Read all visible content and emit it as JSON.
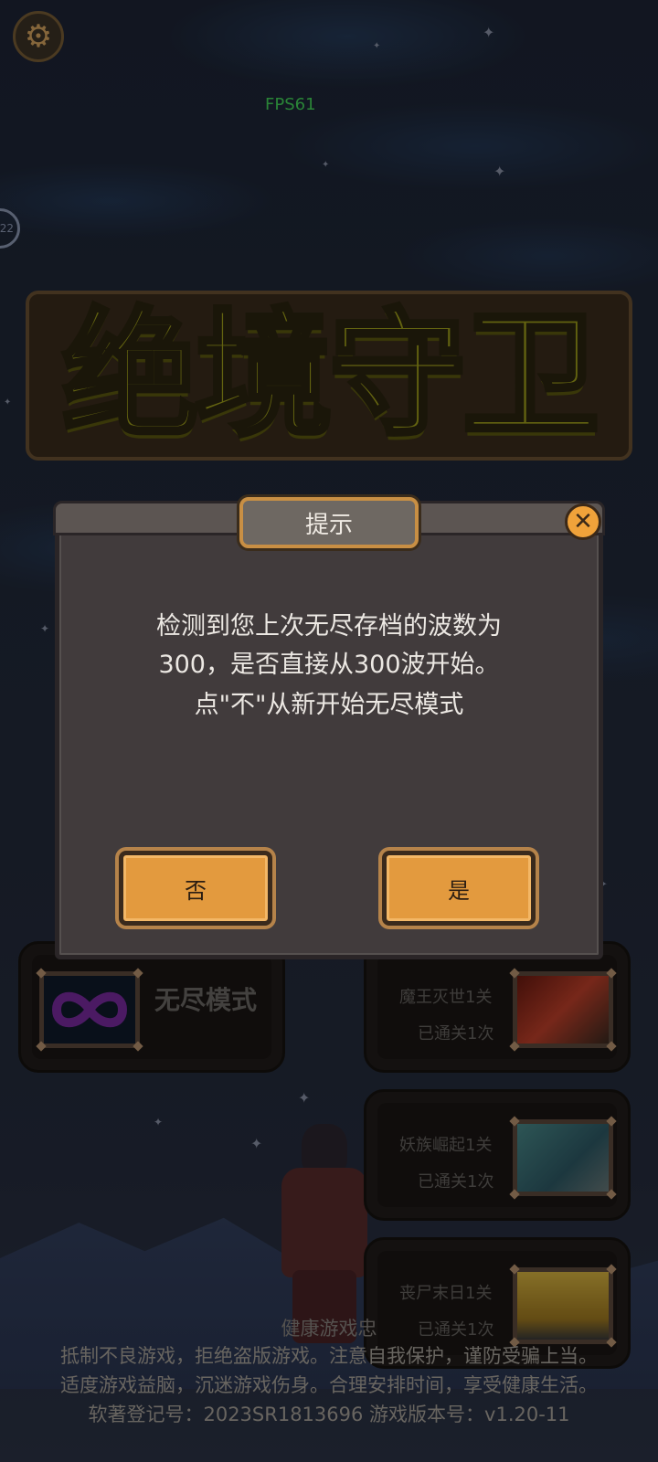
{
  "hud": {
    "fps": "FPS61",
    "edge_badge": "22",
    "settings_icon": "gear-icon"
  },
  "game_title": "绝境守卫",
  "modes": {
    "endless": {
      "label": "无尽模式",
      "icon": "infinity-icon"
    },
    "levels": [
      {
        "name": "魔王灭世1关",
        "status": "已通关1次",
        "thumb": "fire-scene-thumbnail"
      },
      {
        "name": "妖族崛起1关",
        "status": "已通关1次",
        "thumb": "map-thumbnail"
      },
      {
        "name": "丧尸末日1关",
        "status": "已通关1次",
        "thumb": "street-scene-thumbnail"
      }
    ]
  },
  "dialog": {
    "title": "提示",
    "message_lines": [
      "检测到您上次无尽存档的波数为",
      "300，是否直接从300波开始。",
      "点\"不\"从新开始无尽模式"
    ],
    "no_label": "否",
    "yes_label": "是",
    "close_icon": "close-icon"
  },
  "footer": {
    "line0": "健康游戏忠",
    "line1": "抵制不良游戏，拒绝盗版游戏。注意自我保护，谨防受骗上当。",
    "line2": "适度游戏益脑，沉迷游戏伤身。合理安排时间，享受健康生活。",
    "line3": "软著登记号：2023SR1813696   游戏版本号：v1.20-11"
  },
  "colors": {
    "accent_orange": "#e39a3e",
    "title_olive": "#a0a01a",
    "fps_green": "#44d65a",
    "dialog_bg": "#413b3c"
  }
}
